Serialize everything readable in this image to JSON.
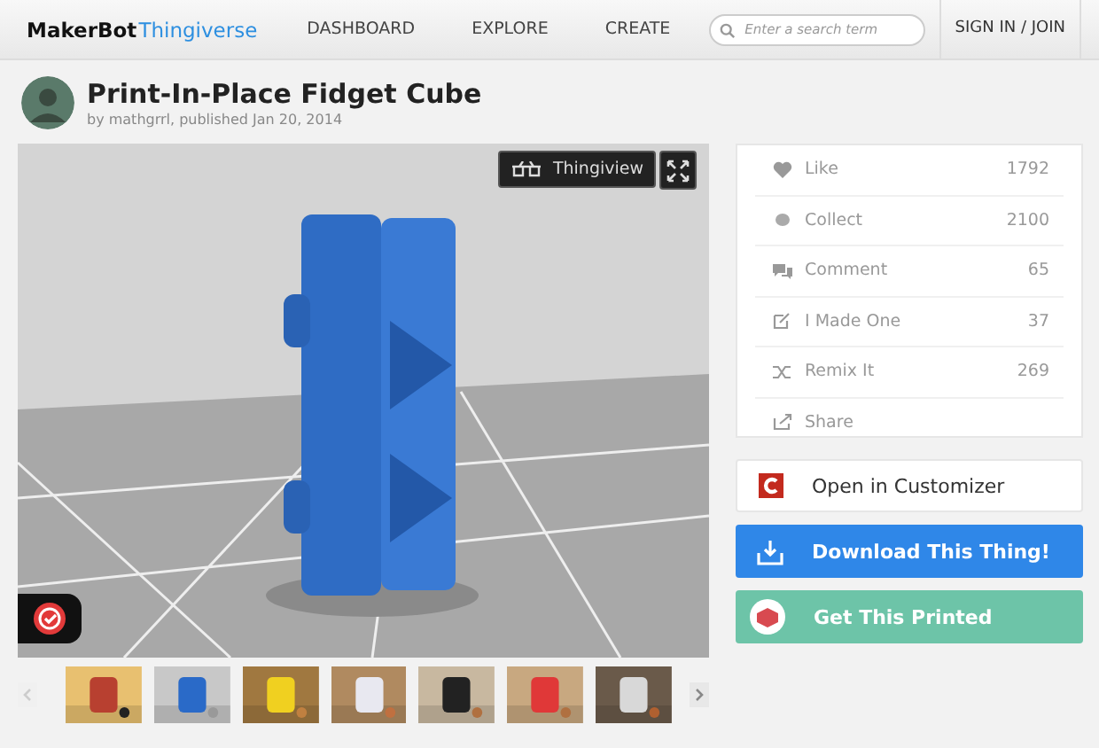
{
  "header": {
    "logo_a": "MakerBot",
    "logo_b": "Thingiverse",
    "nav": [
      "DASHBOARD",
      "EXPLORE",
      "CREATE"
    ],
    "search": {
      "placeholder": "Enter a search term"
    },
    "sign_in": "SIGN IN / JOIN"
  },
  "thing": {
    "title": "Print-In-Place Fidget Cube",
    "byline": "by mathgrrl, published Jan 20, 2014"
  },
  "viewer": {
    "kind": "picture",
    "thingiview": "Thingiview"
  },
  "stats": [
    {
      "label": "Like",
      "count": "1792"
    },
    {
      "label": "Collect",
      "count": "2100"
    },
    {
      "label": "Comment",
      "count": "65"
    },
    {
      "label": "I Made One",
      "count": "37"
    },
    {
      "label": "Remix It",
      "count": "269"
    },
    {
      "label": "Share"
    }
  ],
  "actions": [
    {
      "kind": "customizer",
      "label": "Open in Customizer"
    },
    {
      "kind": "download",
      "label": "Download This Thing!"
    },
    {
      "kind": "print",
      "label": "Get This Printed"
    }
  ]
}
